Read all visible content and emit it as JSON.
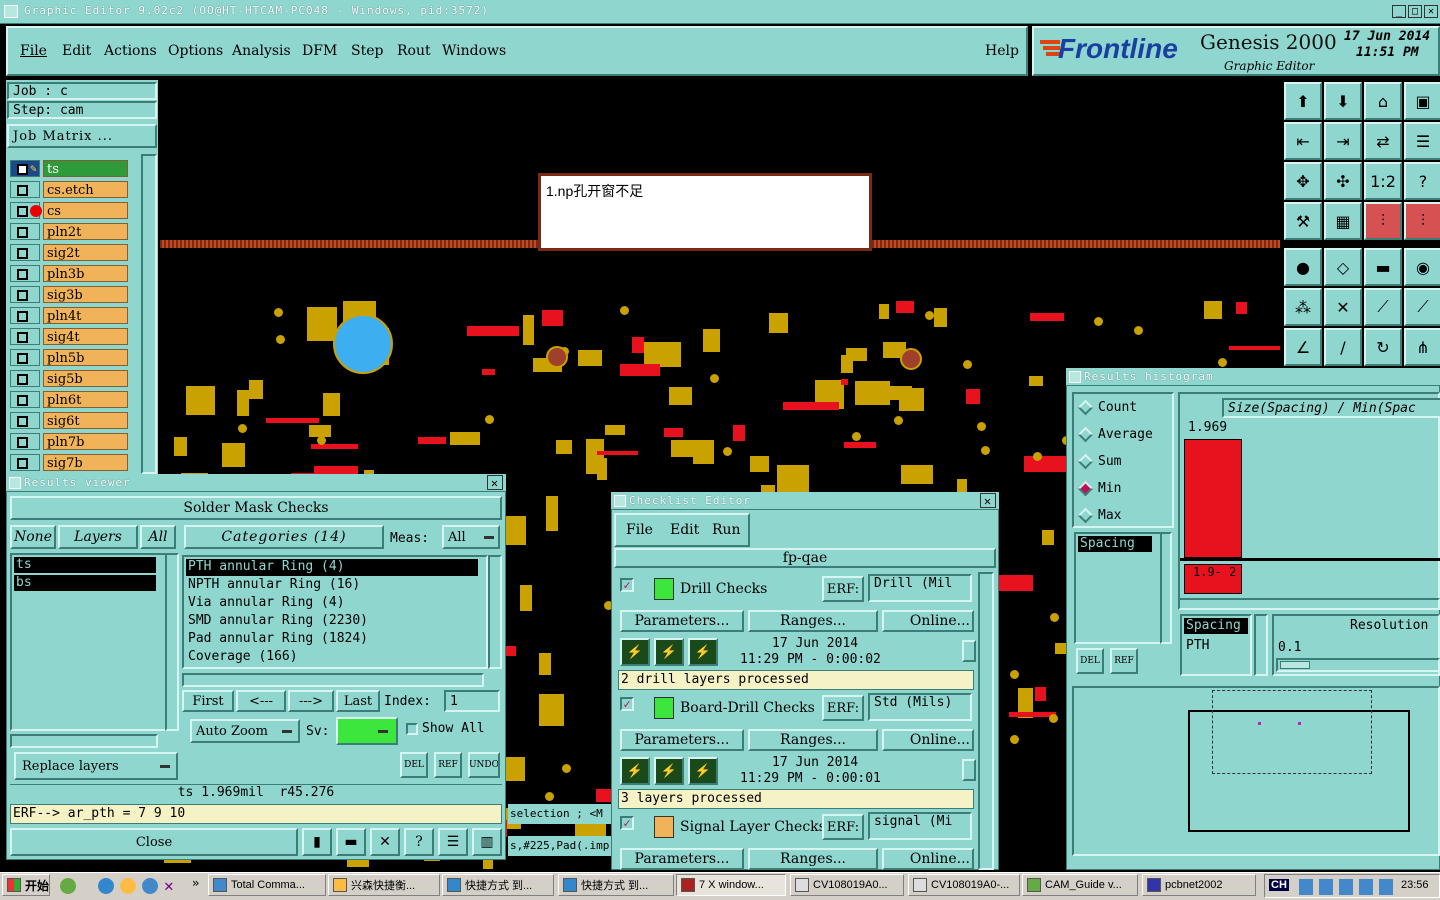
{
  "window": {
    "title": "Graphic Editor 9.02c2 (OO@HT-HTCAM-PC048 - Windows, pid:3572)"
  },
  "menu": {
    "items": [
      "File",
      "Edit",
      "Actions",
      "Options",
      "Analysis",
      "DFM",
      "Step",
      "Rout",
      "Windows"
    ],
    "help": "Help"
  },
  "branding": {
    "logo": "Frontline",
    "product": "Genesis 2000",
    "subtitle": "Graphic Editor",
    "date": "17 Jun 2014",
    "time": "11:51 PM"
  },
  "job": {
    "job": "Job : c",
    "step": "Step: cam",
    "matrix_button": "Job Matrix ..."
  },
  "layers": [
    "ts",
    "cs.etch",
    "cs",
    "pln2t",
    "sig2t",
    "pln3b",
    "sig3b",
    "pln4t",
    "sig4t",
    "pln5b",
    "sig5b",
    "pln6t",
    "sig6t",
    "pln7b",
    "sig7b"
  ],
  "annotation": {
    "text": "1.np孔开窗不足"
  },
  "results_viewer": {
    "title": "Results viewer",
    "header": "Solder Mask Checks",
    "none_btn": "None",
    "layers_btn": "Layers",
    "all_btn": "All",
    "categories_btn": "Categories (14)",
    "meas_label": "Meas:",
    "meas_value": "All",
    "layer_list": [
      "ts",
      "bs"
    ],
    "categories": [
      "PTH annular Ring (4)",
      "NPTH annular Ring (16)",
      "Via annular Ring (4)",
      "SMD annular Ring (2230)",
      "Pad annular Ring (1824)",
      "Coverage (166)"
    ],
    "nav": {
      "first": "First",
      "prev": "<---",
      "next": "--->",
      "last": "Last",
      "index_label": "Index:",
      "index_value": "1"
    },
    "auto_zoom": "Auto Zoom",
    "sv_label": "Sv:",
    "show_all": "Show All",
    "replace_layers": "Replace layers",
    "small_btns": [
      "DEL",
      "REF",
      "UNDO"
    ],
    "status_line": "ts 1.969mil  r45.276",
    "erf_line": "ERF--> ar_pth = 7 9 10",
    "close": "Close"
  },
  "bg_text": {
    "selection": "selection ; <M",
    "pad": "s,#225,Pad(.imp"
  },
  "checklist": {
    "title": "Checklist Editor",
    "menu": [
      "File",
      "Edit",
      "Run"
    ],
    "name": "fp-qae",
    "erf_label": "ERF:",
    "params": "Parameters...",
    "ranges": "Ranges...",
    "online": "Online...",
    "checks": [
      {
        "name": "Drill Checks",
        "erf": "Drill (Mil",
        "date": "17 Jun 2014",
        "time": "11:29 PM - 0:00:02",
        "status": "2 drill layers processed"
      },
      {
        "name": "Board-Drill Checks",
        "erf": "Std (Mils)",
        "date": "17 Jun 2014",
        "time": "11:29 PM - 0:00:01",
        "status": "3 layers processed"
      },
      {
        "name": "Signal Layer Checks",
        "erf": "signal (Mi",
        "date": "",
        "time": "",
        "status": ""
      }
    ]
  },
  "histogram": {
    "title": "Results histogram",
    "options": [
      {
        "label": "Count",
        "selected": false
      },
      {
        "label": "Average",
        "selected": false
      },
      {
        "label": "Sum",
        "selected": false
      },
      {
        "label": "Min",
        "selected": true
      },
      {
        "label": "Max",
        "selected": false
      }
    ],
    "header": "Size(Spacing) / Min(Spac",
    "bar_value": "1.969",
    "bar_label": "1.9- 2",
    "list_selected": "Spacing",
    "del": "DEL",
    "ref": "REF",
    "list2": [
      "Spacing",
      "PTH"
    ],
    "resolution_label": "Resolution",
    "resolution_value": "0.1",
    "bar_fill_fraction": 0.62
  },
  "taskbar": {
    "start": "开始",
    "items": [
      "Total Comma...",
      "兴森快捷衡...",
      "快捷方式 到...",
      "快捷方式 到...",
      "7 X window...",
      "CV108019A0...",
      "CV108019A0-...",
      "CAM_Guide v...",
      "pcbnet2002"
    ],
    "lang": "CH",
    "clock": "23:56"
  },
  "colors": {
    "teal": "#8fd6cf",
    "layer": "#f0b35a",
    "copper": "#c9a100",
    "red": "#e8121e",
    "bar": "#e8121e"
  }
}
